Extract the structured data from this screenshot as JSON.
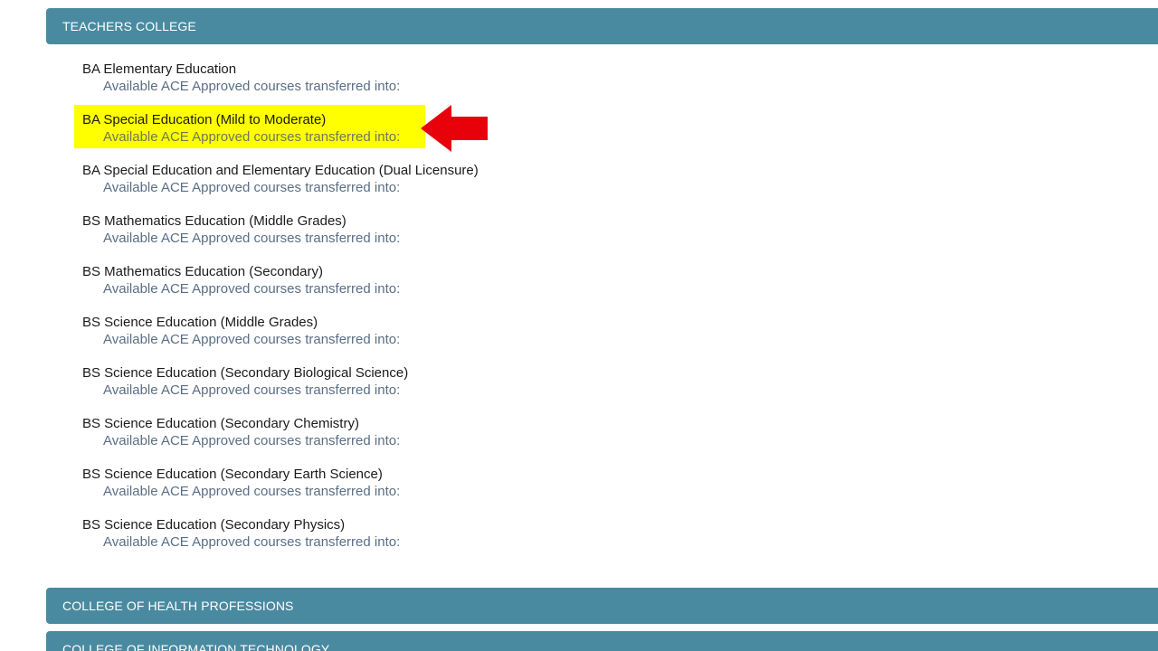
{
  "sections": {
    "teachers_college": "TEACHERS COLLEGE",
    "health_professions": "COLLEGE OF HEALTH PROFESSIONS",
    "information_technology": "COLLEGE OF INFORMATION TECHNOLOGY"
  },
  "programs": [
    {
      "title": "BA Elementary Education",
      "subtitle": "Available ACE Approved courses transferred into:"
    },
    {
      "title": "BA Special Education (Mild to Moderate)",
      "subtitle": "Available ACE Approved courses transferred into:"
    },
    {
      "title": "BA Special Education and Elementary Education (Dual Licensure)",
      "subtitle": "Available ACE Approved courses transferred into:"
    },
    {
      "title": "BS Mathematics Education (Middle Grades)",
      "subtitle": "Available ACE Approved courses transferred into:"
    },
    {
      "title": "BS Mathematics Education (Secondary)",
      "subtitle": "Available ACE Approved courses transferred into:"
    },
    {
      "title": "BS Science Education (Middle Grades)",
      "subtitle": "Available ACE Approved courses transferred into:"
    },
    {
      "title": "BS Science Education (Secondary Biological Science)",
      "subtitle": "Available ACE Approved courses transferred into:"
    },
    {
      "title": "BS Science Education (Secondary Chemistry)",
      "subtitle": "Available ACE Approved courses transferred into:"
    },
    {
      "title": "BS Science Education (Secondary Earth Science)",
      "subtitle": "Available ACE Approved courses transferred into:"
    },
    {
      "title": "BS Science Education (Secondary Physics)",
      "subtitle": "Available ACE Approved courses transferred into:"
    }
  ],
  "highlight": {
    "color": "#ffff00",
    "arrow_color": "#e8000b",
    "arrow_icon": "left-arrow-icon"
  },
  "colors": {
    "header_bg": "#4a8aa0",
    "header_text": "#ffffff"
  }
}
